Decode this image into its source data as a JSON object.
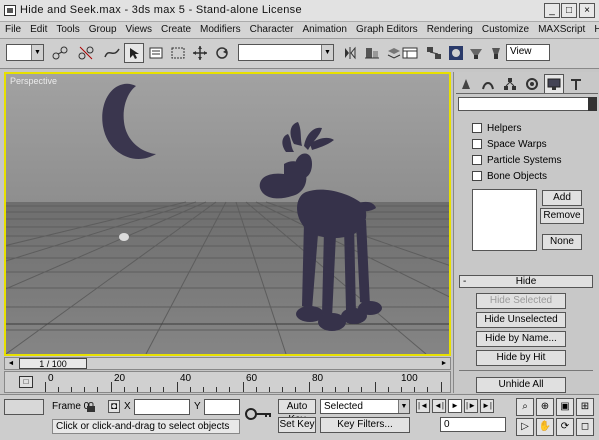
{
  "window": {
    "title": "Hide and Seek.max - 3ds max 5 - Stand-alone License",
    "min": "_",
    "max": "□",
    "close": "×"
  },
  "menu": [
    "File",
    "Edit",
    "Tools",
    "Group",
    "Views",
    "Create",
    "Modifiers",
    "Character",
    "Animation",
    "Graph Editors",
    "Rendering",
    "Customize",
    "MAXScript",
    "Help"
  ],
  "toolbar": {
    "view_label": "View",
    "selection_filter": "",
    "named_selection": ""
  },
  "viewport": {
    "label": "Perspective",
    "sky_color": "#9b9b9b",
    "ground_color": "#7a7a7a",
    "object_color": "#38344c"
  },
  "timeline": {
    "slider_label": "1 / 100",
    "ticks": [
      "0",
      "20",
      "40",
      "60",
      "80",
      "100"
    ]
  },
  "status": {
    "frame_label": "Frame 0",
    "x_label": "X",
    "y_label": "Y",
    "x_value": "",
    "y_value": "",
    "auto_key": "Auto Key",
    "set_key": "Set Key",
    "key_mode": "Selected",
    "key_filters": "Key Filters...",
    "prompt": "Click or click-and-drag to select objects",
    "frame_field": "0",
    "lock_icon": "lock-icon",
    "key_icon": "key-icon"
  },
  "command_panel": {
    "categories": [
      "Helpers",
      "Space Warps",
      "Particle Systems",
      "Bone Objects"
    ],
    "add": "Add",
    "remove": "Remove",
    "none": "None",
    "rollout_title": "Hide",
    "rollout_minus": "-",
    "hide_buttons": [
      "Hide Selected",
      "Hide Unselected",
      "Hide by Name...",
      "Hide by Hit"
    ],
    "unhide_all": "Unhide All"
  }
}
